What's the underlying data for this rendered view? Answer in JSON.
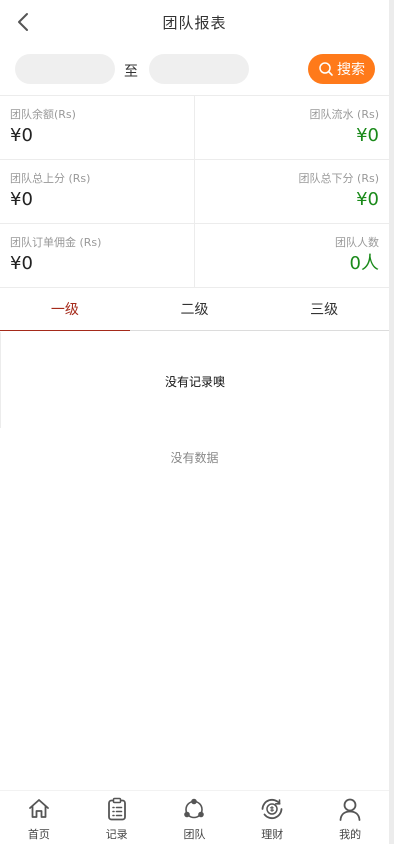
{
  "header": {
    "title": "团队报表"
  },
  "filter": {
    "start_value": "",
    "end_value": "",
    "to_label": "至",
    "search_label": "搜索"
  },
  "stats": [
    {
      "left_label": "团队余额(Rs)",
      "left_value": "¥0",
      "right_label": "团队流水 (Rs)",
      "right_value": "¥0"
    },
    {
      "left_label": "团队总上分 (Rs)",
      "left_value": "¥0",
      "right_label": "团队总下分 (Rs)",
      "right_value": "¥0"
    },
    {
      "left_label": "团队订单佣金 (Rs)",
      "left_value": "¥0",
      "right_label": "团队人数",
      "right_value": "0人"
    }
  ],
  "tabs": [
    {
      "label": "一级",
      "active": true
    },
    {
      "label": "二级",
      "active": false
    },
    {
      "label": "三级",
      "active": false
    }
  ],
  "records": {
    "empty_text": "没有记录噢"
  },
  "no_data_text": "没有数据",
  "colors": {
    "accent": "#ff7a1a",
    "positive": "#1a8a1a",
    "active_tab": "#a52a1a"
  },
  "bottom_nav": [
    {
      "label": "首页",
      "icon": "home-icon"
    },
    {
      "label": "记录",
      "icon": "clipboard-icon"
    },
    {
      "label": "团队",
      "icon": "team-icon"
    },
    {
      "label": "理财",
      "icon": "finance-icon"
    },
    {
      "label": "我的",
      "icon": "user-icon"
    }
  ]
}
